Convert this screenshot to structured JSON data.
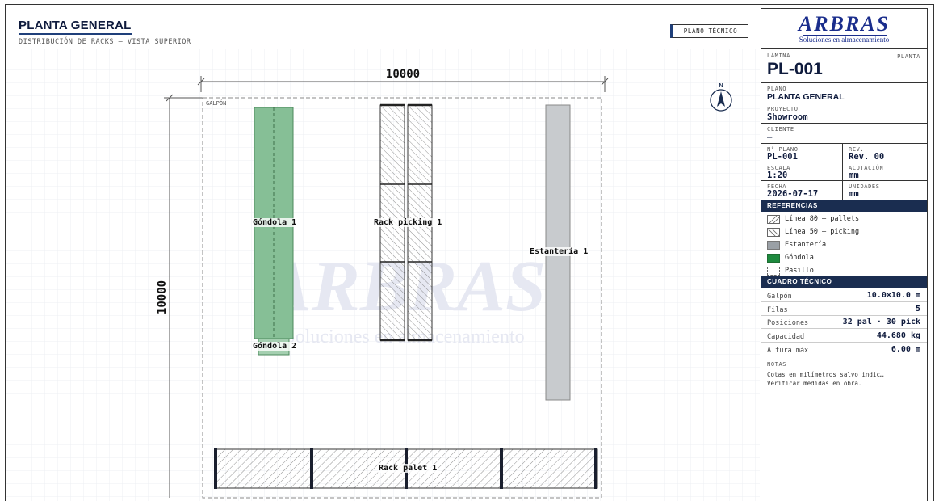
{
  "header": {
    "title": "PLANTA GENERAL",
    "subtitle": "DISTRIBUCIÓN DE RACKS — VISTA SUPERIOR",
    "badge": "PLANO TÉCNICO"
  },
  "drawing": {
    "dim_width": "10000",
    "dim_height": "10000",
    "area_label": "GALPÓN",
    "north": "N",
    "watermark_word": "ARBRAS",
    "watermark_tag": "Soluciones en almacenamiento",
    "elements": {
      "gondola1": "Góndola 1",
      "gondola2": "Góndola 2",
      "rack_picking": "Rack picking 1",
      "estanteria": "Estantería 1",
      "rack_palet": "Rack palet 1"
    }
  },
  "panel": {
    "logo_word": "ARBRAS",
    "logo_tag": "Soluciones en almacenamiento",
    "lamina_label": "LÁMINA",
    "lamina_type": "PLANTA",
    "lamina_code": "PL-001",
    "plano_label": "PLANO",
    "plano_value": "PLANTA GENERAL",
    "proyecto_label": "PROYECTO",
    "proyecto_value": "Showroom",
    "cliente_label": "CLIENTE",
    "cliente_value": "—",
    "nplano_label": "N° PLANO",
    "nplano_value": "PL-001",
    "rev_label": "REV.",
    "rev_value": "Rev. 00",
    "escala_label": "ESCALA",
    "escala_value": "1:20",
    "acot_label": "ACOTACIÓN",
    "acot_value": "mm",
    "fecha_label": "FECHA",
    "fecha_value": "2026-07-17",
    "unidades_label": "UNIDADES",
    "unidades_value": "mm",
    "refs_title": "REFERENCIAS",
    "refs": [
      {
        "label": "Línea 80 — pallets",
        "style": "hatch80"
      },
      {
        "label": "Línea 50 — picking",
        "style": "hatch50"
      },
      {
        "label": "Estantería",
        "style": "#9aa0a6"
      },
      {
        "label": "Góndola",
        "style": "#1e8a3e"
      },
      {
        "label": "Pasillo",
        "style": "dashed"
      }
    ],
    "tech_title": "CUADRO TÉCNICO",
    "tech": [
      {
        "k": "Galpón",
        "v": "10.0×10.0 m"
      },
      {
        "k": "Filas",
        "v": "5"
      },
      {
        "k": "Posiciones",
        "v": "32 pal · 30 pick"
      },
      {
        "k": "Capacidad",
        "v": "44.680 kg"
      },
      {
        "k": "Altura máx",
        "v": "6.00 m"
      }
    ],
    "notas_label": "NOTAS",
    "notas_lines": [
      "Cotas en milímetros salvo indic…",
      "Verificar medidas en obra."
    ]
  },
  "colors": {
    "navy": "#1a2d50",
    "brand": "#1a2d8c",
    "gondola": "#86bf96",
    "estanteria": "#c8cbce"
  }
}
